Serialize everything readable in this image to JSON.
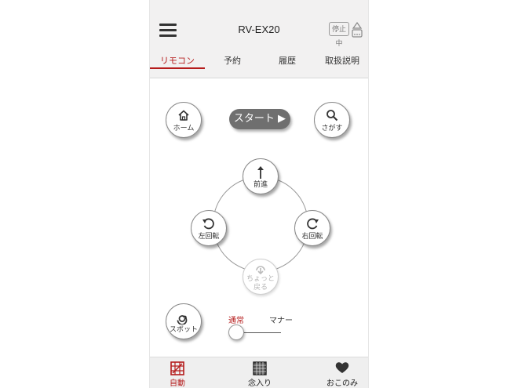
{
  "header": {
    "title": "RV-EX20",
    "status_label": "停止中"
  },
  "tabs": [
    {
      "label": "リモコン",
      "active": true
    },
    {
      "label": "予約",
      "active": false
    },
    {
      "label": "履歴",
      "active": false
    },
    {
      "label": "取扱説明",
      "active": false
    }
  ],
  "controls": {
    "home_label": "ホーム",
    "start_label": "スタート ▶",
    "search_label": "さがす",
    "forward_label": "前進",
    "left_label": "左回転",
    "right_label": "右回転",
    "back_line1": "ちょっと",
    "back_line2": "戻る",
    "spot_label": "スポット"
  },
  "mode": {
    "normal_label": "通常",
    "manner_label": "マナー",
    "selected": "通常"
  },
  "bottom_nav": [
    {
      "label": "自動",
      "icon": "auto-clean-icon",
      "active": true
    },
    {
      "label": "念入り",
      "icon": "thorough-clean-icon",
      "active": false
    },
    {
      "label": "おこのみ",
      "icon": "heart-icon",
      "active": false
    }
  ],
  "colors": {
    "accent": "#b51c1c",
    "start_button": "#6f6f6f"
  }
}
